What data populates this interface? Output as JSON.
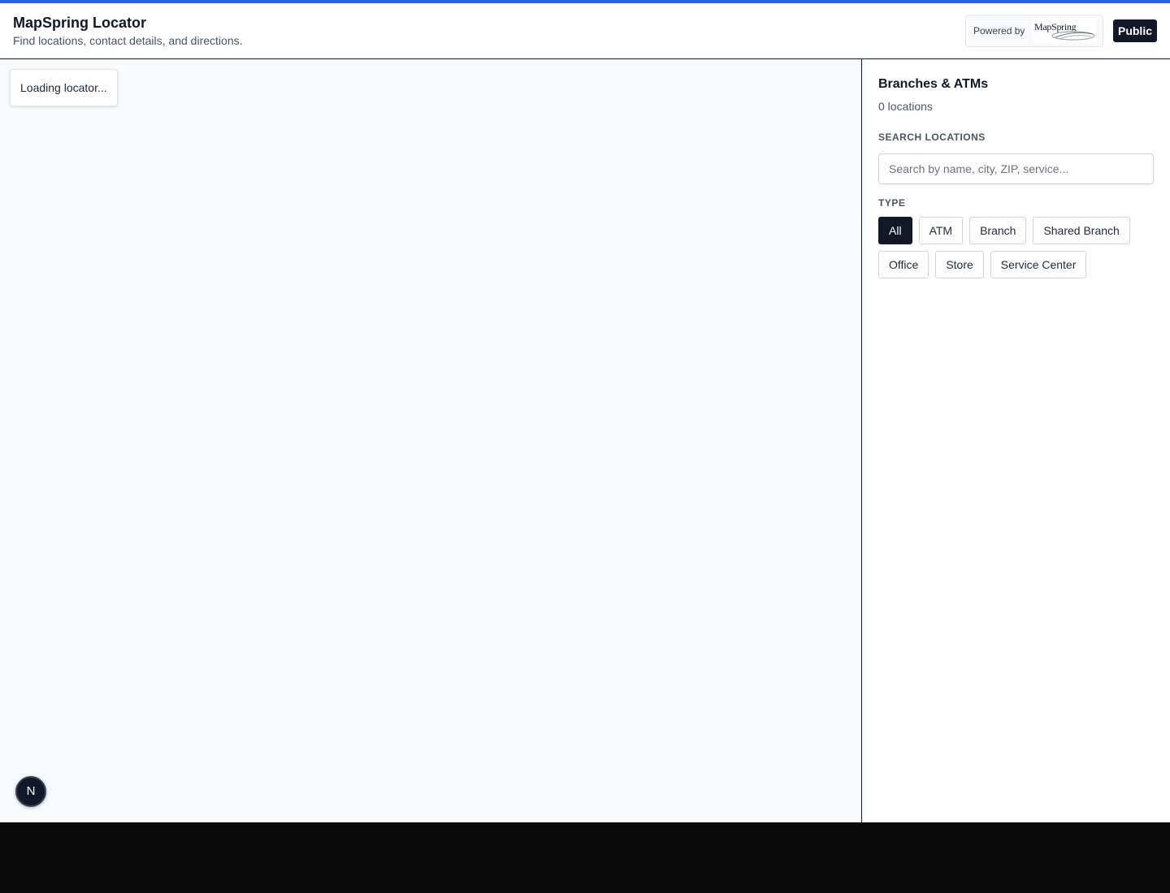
{
  "header": {
    "title": "MapSpring Locator",
    "subtitle": "Find locations, contact details, and directions.",
    "powered_by": "Powered by",
    "logo_text": "MapSpring",
    "visibility_badge": "Public"
  },
  "map": {
    "loading_text": "Loading locator...",
    "fab_letter": "N"
  },
  "sidebar": {
    "title": "Branches & ATMs",
    "count": "0 locations",
    "search_label": "SEARCH LOCATIONS",
    "search_placeholder": "Search by name, city, ZIP, service...",
    "search_value": "",
    "type_label": "TYPE",
    "types": [
      "All",
      "ATM",
      "Branch",
      "Shared Branch",
      "Office",
      "Store",
      "Service Center"
    ],
    "active_type": "All"
  },
  "colors": {
    "accent": "#2563eb",
    "dark": "#111827"
  }
}
